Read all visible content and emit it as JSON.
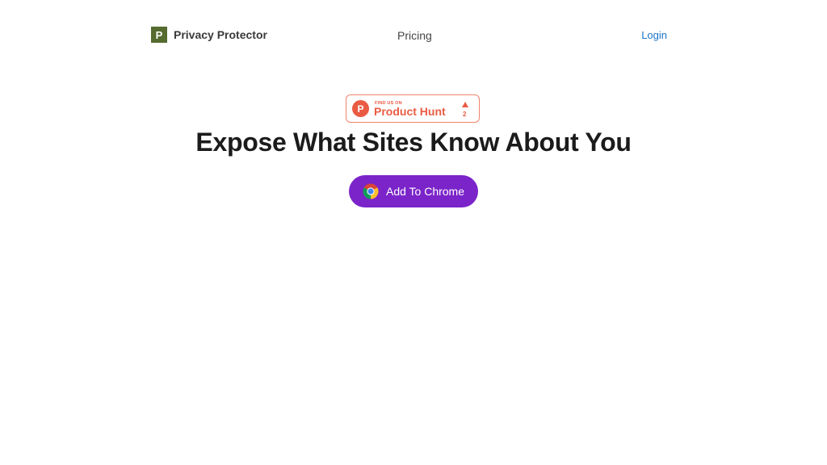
{
  "header": {
    "brand_initial": "P",
    "brand_name": "Privacy Protector",
    "nav_pricing": "Pricing",
    "nav_login": "Login"
  },
  "product_hunt": {
    "logo_letter": "P",
    "tagline": "FIND US ON",
    "name": "Product Hunt",
    "upvotes": "2",
    "icon": "upvote-triangle-icon"
  },
  "hero": {
    "headline": "Expose What Sites Know About You",
    "cta_label": "Add To Chrome",
    "cta_icon": "chrome-icon"
  },
  "colors": {
    "brand_logo": "#556b2f",
    "product_hunt": "#ea5b43",
    "cta_background": "#7b24c9",
    "login_link": "#1a73c8"
  }
}
